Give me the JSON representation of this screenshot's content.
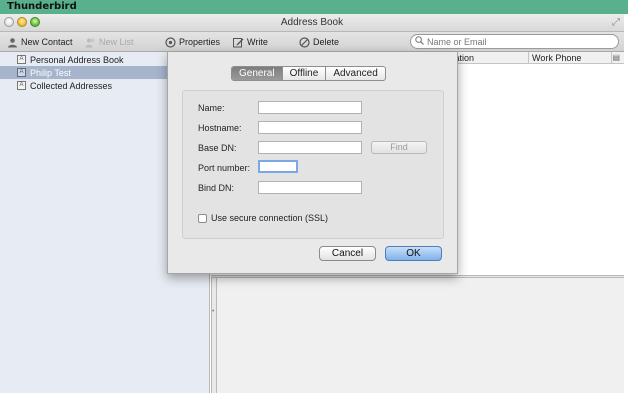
{
  "app": {
    "name": "Thunderbird"
  },
  "window": {
    "title": "Address Book"
  },
  "toolbar": {
    "new_contact": "New Contact",
    "new_list": "New List",
    "properties": "Properties",
    "write": "Write",
    "delete": "Delete",
    "search_placeholder": "Name or Email"
  },
  "sidebar": {
    "items": [
      {
        "label": "Personal Address Book",
        "selected": false
      },
      {
        "label": "Philip Test",
        "selected": true
      },
      {
        "label": "Collected Addresses",
        "selected": false
      }
    ]
  },
  "columns": {
    "organization": "Organization",
    "work_phone": "Work Phone"
  },
  "dialog": {
    "tabs": [
      "General",
      "Offline",
      "Advanced"
    ],
    "active_tab": "General",
    "fields": {
      "name": {
        "label": "Name:",
        "value": ""
      },
      "hostname": {
        "label": "Hostname:",
        "value": ""
      },
      "base_dn": {
        "label": "Base DN:",
        "value": ""
      },
      "port_number": {
        "label": "Port number:",
        "value": ""
      },
      "bind_dn": {
        "label": "Bind DN:",
        "value": ""
      }
    },
    "find_label": "Find",
    "ssl_label": "Use secure connection (SSL)",
    "ssl_checked": false,
    "cancel_label": "Cancel",
    "ok_label": "OK"
  }
}
